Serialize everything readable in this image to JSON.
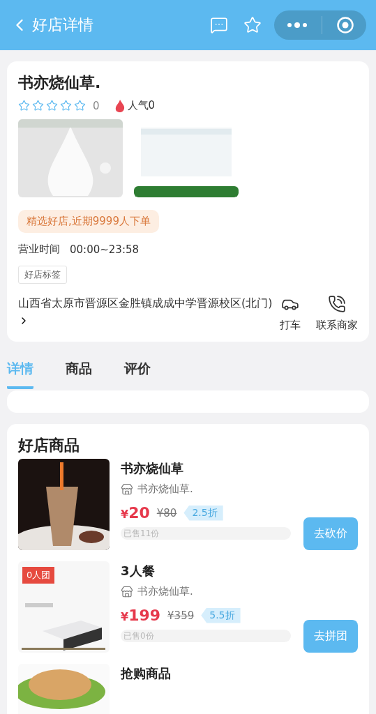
{
  "header": {
    "title": "好店详情"
  },
  "shop": {
    "name": "书亦烧仙草.",
    "stars": 0,
    "rating": "0",
    "popularity": "人气0",
    "photos": [
      {
        "kind": "picture"
      },
      {
        "kind": "picture"
      }
    ],
    "promo": "精选好店,近期9999人下单",
    "hours_label": "营业时间",
    "hours": "00:00~23:58",
    "tag": "好店标签",
    "address": "山西省太原市晋源区金胜镇成成中学晋源校区(北门)",
    "actions": [
      {
        "kind": "taxi",
        "label": "打车"
      },
      {
        "kind": "phone",
        "label": "联系商家"
      }
    ]
  },
  "tabs": [
    {
      "label": "详情",
      "selected": true
    },
    {
      "label": "商品",
      "selected": false
    },
    {
      "label": "评价",
      "selected": false
    }
  ],
  "products_section": {
    "title": "好店商品",
    "items": [
      {
        "name": "书亦烧仙草",
        "shop": "书亦烧仙草.",
        "currency": "¥",
        "price": "20",
        "original_price": "¥80",
        "discount": "2.5折",
        "sold": "已售11份",
        "button": "去砍价",
        "kind": "picture"
      },
      {
        "name": "3人餐",
        "shop": "书亦烧仙草.",
        "currency": "¥",
        "price": "199",
        "original_price": "¥359",
        "discount": "5.5折",
        "sold": "已售0份",
        "button": "去拼团",
        "badge": "0人团",
        "kind": "picture"
      },
      {
        "name": "抢购商品",
        "kind": "picture"
      }
    ]
  }
}
